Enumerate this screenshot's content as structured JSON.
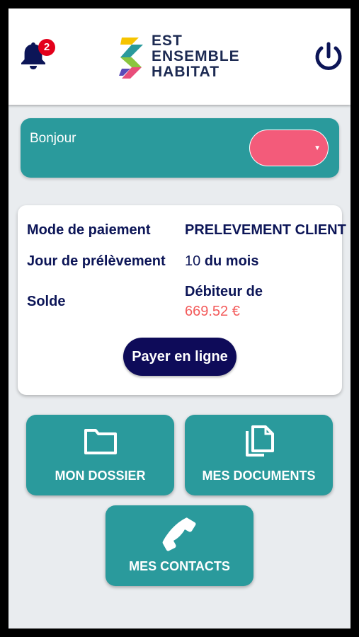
{
  "header": {
    "notifications_count": "2",
    "logo_lines": [
      "EST",
      "ENSEMBLE",
      "HABITAT"
    ]
  },
  "greeting": {
    "text": "Bonjour",
    "dropdown_value": "",
    "dropdown_color": "#f35b7a"
  },
  "account": {
    "payment_mode_label": "Mode de paiement",
    "payment_mode_value": "PRELEVEMENT CLIENT",
    "debit_day_label": "Jour de prélèvement",
    "debit_day_number": "10",
    "debit_day_suffix": "du mois",
    "balance_label": "Solde",
    "balance_status": "Débiteur de",
    "balance_amount": "669.52 €",
    "pay_button": "Payer en ligne"
  },
  "tiles": {
    "dossier": "MON DOSSIER",
    "documents": "MES DOCUMENTS",
    "contacts": "MES CONTACTS"
  },
  "colors": {
    "teal": "#2a9a9c",
    "navy": "#0c1557",
    "pink": "#f35b7a",
    "badge_red": "#e3001b"
  },
  "icons": [
    "bell-icon",
    "power-icon",
    "folder-icon",
    "documents-icon",
    "phone-icon"
  ]
}
